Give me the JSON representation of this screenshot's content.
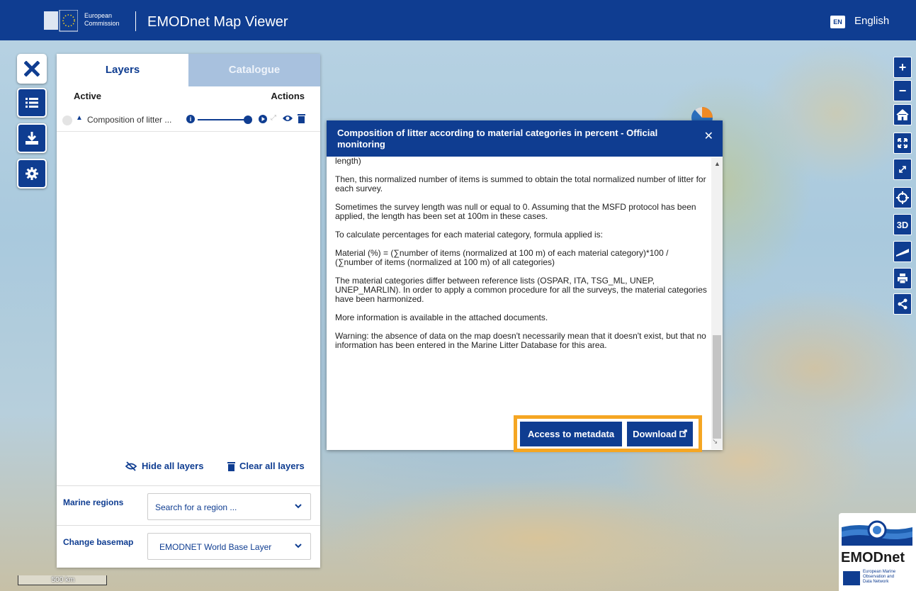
{
  "header": {
    "ec_line1": "European",
    "ec_line2": "Commission",
    "title": "EMODnet Map Viewer",
    "lang_code": "EN",
    "lang_label": "English"
  },
  "sidebar_tools": [
    {
      "name": "close",
      "icon": "close-icon"
    },
    {
      "name": "layers",
      "icon": "list-icon"
    },
    {
      "name": "download",
      "icon": "download-icon"
    },
    {
      "name": "settings",
      "icon": "gear-icon"
    }
  ],
  "panel": {
    "tabs": [
      "Layers",
      "Catalogue"
    ],
    "active_tab": "Layers",
    "col_active": "Active",
    "col_actions": "Actions",
    "layer": {
      "name": "Composition of litter ...",
      "opacity": 1.0
    },
    "hide_all": "Hide all layers",
    "clear_all": "Clear all layers",
    "marine_label": "Marine regions",
    "marine_placeholder": "Search for a region ...",
    "basemap_label": "Change basemap",
    "basemap_value": "EMODNET World Base Layer"
  },
  "popup": {
    "title": "Composition of litter according to material categories in percent - Official monitoring",
    "paragraphs": [
      "length)",
      "Then, this normalized number of items is summed to obtain the total normalized number of litter for each survey.",
      "Sometimes the survey length was null or equal to 0. Assuming that the MSFD protocol has been applied, the length has been set at 100m in these cases.",
      "To calculate percentages for each material category, formula applied is:",
      "Material (%) = (∑number of items (normalized at 100 m) of each material category)*100 / (∑number of items (normalized at 100 m) of all categories)",
      "The material categories differ between reference lists (OSPAR, ITA, TSG_ML, UNEP, UNEP_MARLIN). In order to apply a common procedure for all the surveys, the material categories have been harmonized.",
      "More information is available in the attached documents.",
      "Warning: the absence of data on the map doesn't necessarily mean that it doesn't exist, but that no information has been entered in the Marine Litter Database for this area."
    ],
    "access_btn": "Access to metadata",
    "download_btn": "Download"
  },
  "map_tools": {
    "zoom_in": "+",
    "zoom_out": "−",
    "three_d": "3D"
  },
  "scale_label": "500 km",
  "logo": {
    "name": "EMODnet",
    "sub1": "European Marine",
    "sub2": "Observation and",
    "sub3": "Data Network"
  },
  "colors": {
    "brand": "#0f3d91",
    "highlight": "#f5a623",
    "tab_inactive": "#a8c1de"
  }
}
